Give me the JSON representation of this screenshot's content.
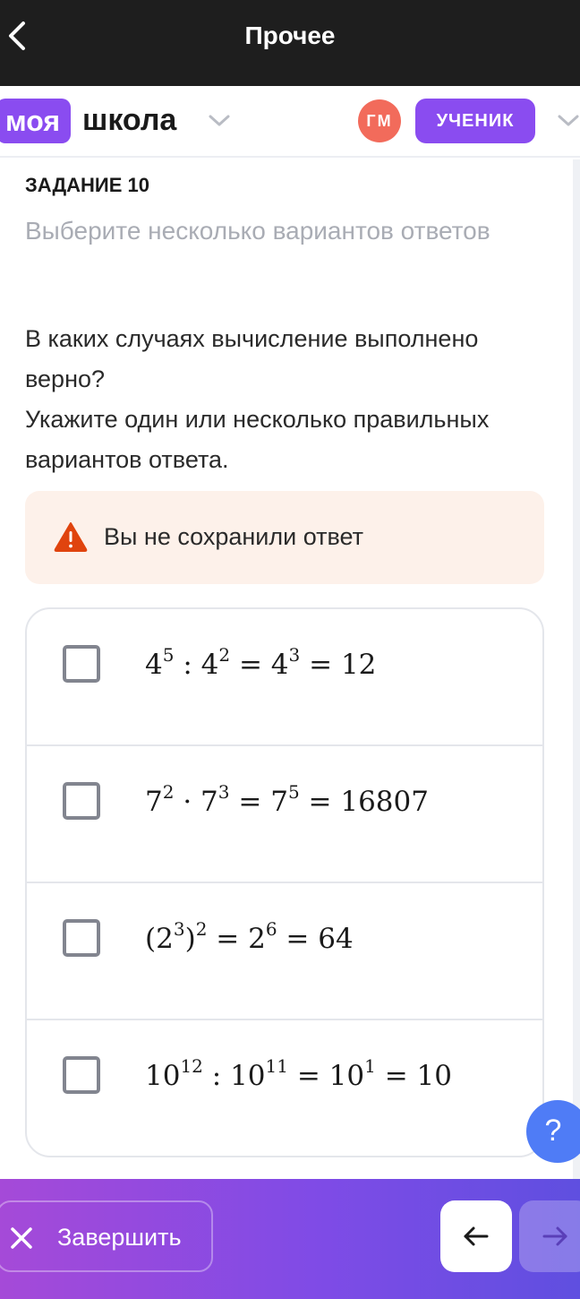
{
  "topbar": {
    "title": "Прочее",
    "back_icon": "chevron-left-icon"
  },
  "header": {
    "logo_badge": "моя",
    "logo_text": "школа",
    "avatar_initials": "ГМ",
    "role": "УЧЕНИК",
    "colors": {
      "brand": "#8a4cf0",
      "avatar": "#f26b5b"
    }
  },
  "task": {
    "label": "ЗАДАНИЕ 10",
    "hint": "Выберите несколько вариантов ответов",
    "question_line1": "В каких случаях вычисление выполнено верно?",
    "question_line2": "Укажите один или несколько правильных вариантов ответа."
  },
  "alert": {
    "icon": "warning-icon",
    "message": "Вы не сохранили ответ",
    "color": "#e0440e"
  },
  "options": [
    {
      "checked": false,
      "base1": "4",
      "exp1": "5",
      "op": ":",
      "base2": "4",
      "exp2": "2",
      "base3": "4",
      "exp3": "3",
      "result": "12"
    },
    {
      "checked": false,
      "base1": "7",
      "exp1": "2",
      "op": "·",
      "base2": "7",
      "exp2": "3",
      "base3": "7",
      "exp3": "5",
      "result": "16807"
    },
    {
      "checked": false,
      "base1": "2",
      "exp1": "3",
      "outer_exp": "2",
      "base3": "2",
      "exp3": "6",
      "result": "64"
    },
    {
      "checked": false,
      "base1": "10",
      "exp1": "12",
      "op": ":",
      "base2": "10",
      "exp2": "11",
      "base3": "10",
      "exp3": "1",
      "result": "10"
    }
  ],
  "help": {
    "label": "?",
    "color": "#4f7cf6"
  },
  "footer": {
    "finish_label": "Завершить",
    "finish_icon": "close-icon",
    "prev_icon": "arrow-left-icon",
    "next_icon": "arrow-right-icon"
  }
}
